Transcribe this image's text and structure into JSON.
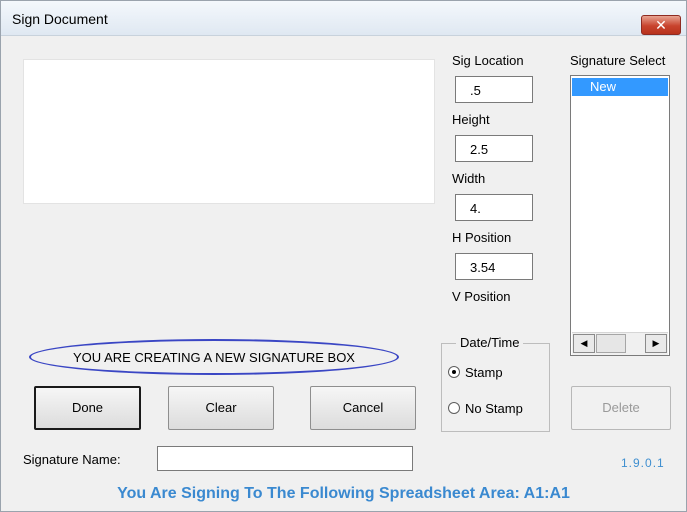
{
  "window": {
    "title": "Sign Document",
    "close_glyph": "✕"
  },
  "fields": {
    "sig_location": {
      "label": "Sig Location",
      "value": ".5"
    },
    "height": {
      "label": "Height",
      "value": "2.5"
    },
    "width": {
      "label": "Width",
      "value": "4."
    },
    "h_position": {
      "label": "H Position",
      "value": "3.54"
    },
    "v_position": {
      "label": "V Position"
    }
  },
  "signature_select": {
    "label": "Signature Select",
    "items": [
      "New"
    ],
    "selected": "New",
    "scroll_left": "◀",
    "scroll_right": "▶"
  },
  "notice": "YOU ARE CREATING A NEW SIGNATURE BOX",
  "date_time": {
    "title": "Date/Time",
    "options": [
      "Stamp",
      "No Stamp"
    ],
    "selected": "Stamp"
  },
  "buttons": {
    "done": "Done",
    "clear": "Clear",
    "cancel": "Cancel",
    "delete": "Delete"
  },
  "signature_name": {
    "label": "Signature Name:",
    "value": ""
  },
  "version": "1.9.0.1",
  "footer": "You Are Signing To The Following Spreadsheet Area: A1:A1",
  "colors": {
    "accent": "#3a89d0",
    "selection": "#3399ff",
    "notice_ellipse": "#3a46c4",
    "close_button": "#c8432d"
  }
}
